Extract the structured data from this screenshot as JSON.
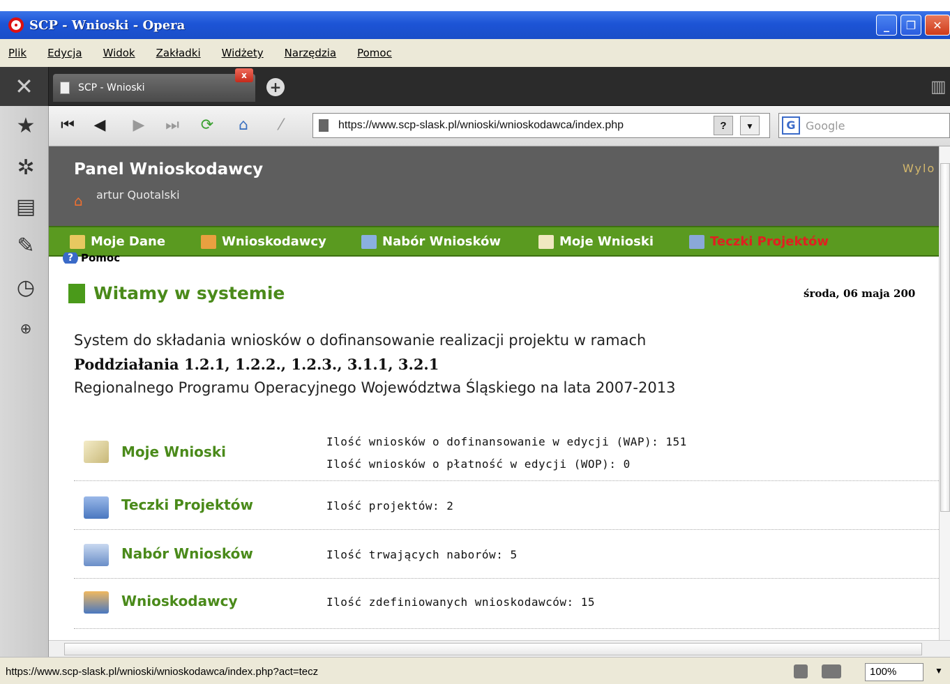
{
  "window": {
    "title": "SCP - Wnioski - Opera"
  },
  "menu": [
    "Plik",
    "Edycja",
    "Widok",
    "Zakładki",
    "Widżety",
    "Narzędzia",
    "Pomoc"
  ],
  "tabs": [
    {
      "label": "SCP - Wnioski",
      "active": true
    }
  ],
  "address": {
    "url": "https://www.scp-slask.pl/wnioski/wnioskodawca/index.php",
    "qmark": "?"
  },
  "search": {
    "placeholder": "Google",
    "engine_letter": "G"
  },
  "page": {
    "panel_title": "Panel Wnioskodawcy",
    "user": "artur Quotalski",
    "logout": "Wylo",
    "nav": [
      {
        "label": "Moje Dane",
        "icon": "card-icon",
        "active": false
      },
      {
        "label": "Wnioskodawcy",
        "icon": "users-icon",
        "active": false
      },
      {
        "label": "Nabór Wniosków",
        "icon": "inbox-icon",
        "active": false
      },
      {
        "label": "Moje Wnioski",
        "icon": "notepad-icon",
        "active": false
      },
      {
        "label": "Teczki Projektów",
        "icon": "folder-icon",
        "active": true
      }
    ],
    "help": "Pomoc",
    "welcome": "Witamy w systemie",
    "date": "środa, 06 maja 200",
    "intro_line1": "System do składania wniosków o dofinansowanie realizacji projektu w ramach",
    "intro_line2": "Poddziałania 1.2.1, 1.2.2., 1.2.3., 3.1.1, 3.2.1",
    "intro_line3": "Regionalnego Programu Operacyjnego Województwa Śląskiego na lata 2007-2013",
    "summary": [
      {
        "label": "Moje Wnioski",
        "icon": "notepad-icon",
        "lines": [
          "Ilość wniosków o dofinansowanie w edycji (WAP): 151",
          "Ilość wniosków o płatność w edycji (WOP): 0"
        ]
      },
      {
        "label": "Teczki Projektów",
        "icon": "folder-icon",
        "lines": [
          "Ilość projektów: 2"
        ]
      },
      {
        "label": "Nabór Wniosków",
        "icon": "inbox-icon",
        "lines": [
          "Ilość trwających naborów: 5"
        ]
      },
      {
        "label": "Wnioskodawcy",
        "icon": "users-icon",
        "lines": [
          "Ilość zdefiniowanych wnioskodawców: 15"
        ]
      }
    ]
  },
  "status": {
    "url": "https://www.scp-slask.pl/wnioski/wnioskodawca/index.php?act=tecz",
    "zoom": "100%"
  },
  "colors": {
    "green_nav": "#5a9a20",
    "active_nav": "#e02020",
    "header_gray": "#5e5e5e",
    "label_green": "#4a8a1a"
  }
}
